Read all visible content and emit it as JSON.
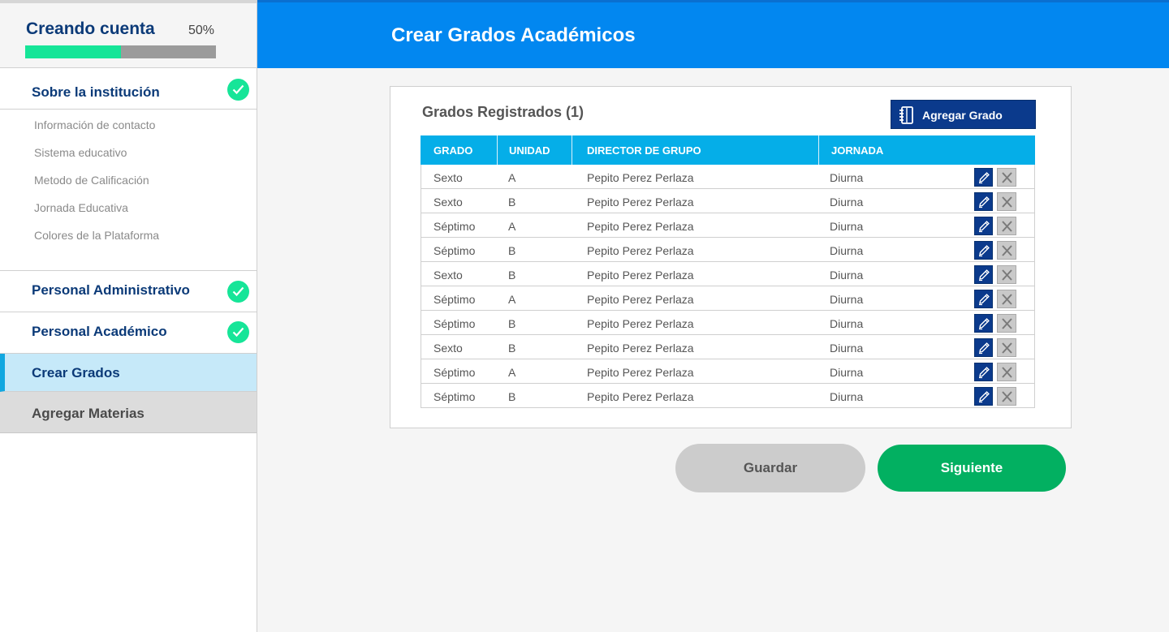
{
  "sidebar": {
    "progress": {
      "title": "Creando cuenta",
      "percent_label": "50%",
      "value": 0.5
    },
    "sections": [
      {
        "label": "Sobre la institución",
        "completed": true
      },
      {
        "label": "Personal Administrativo",
        "completed": true
      },
      {
        "label": "Personal Académico",
        "completed": true
      }
    ],
    "sub_items": [
      "Información de contacto",
      "Sistema educativo",
      "Metodo de Calificación",
      "Jornada Educativa",
      "Colores de la Plataforma"
    ],
    "active_step": "Crear Grados",
    "pending_step": "Agregar Materias"
  },
  "header": {
    "title": "Crear Grados Académicos"
  },
  "card": {
    "title": "Grados Registrados (1)",
    "add_button": "Agregar Grado",
    "columns": [
      "GRADO",
      "UNIDAD",
      "DIRECTOR DE GRUPO",
      "JORNADA"
    ],
    "rows": [
      [
        "Sexto",
        "A",
        "Pepito Perez Perlaza",
        "Diurna"
      ],
      [
        "Sexto",
        "B",
        "Pepito Perez Perlaza",
        "Diurna"
      ],
      [
        "Séptimo",
        "A",
        "Pepito Perez Perlaza",
        "Diurna"
      ],
      [
        "Séptimo",
        "B",
        "Pepito Perez Perlaza",
        "Diurna"
      ],
      [
        "Sexto",
        "B",
        "Pepito Perez Perlaza",
        "Diurna"
      ],
      [
        "Séptimo",
        "A",
        "Pepito Perez Perlaza",
        "Diurna"
      ],
      [
        "Séptimo",
        "B",
        "Pepito Perez Perlaza",
        "Diurna"
      ],
      [
        "Sexto",
        "B",
        "Pepito Perez Perlaza",
        "Diurna"
      ],
      [
        "Séptimo",
        "A",
        "Pepito Perez Perlaza",
        "Diurna"
      ],
      [
        "Séptimo",
        "B",
        "Pepito Perez Perlaza",
        "Diurna"
      ]
    ],
    "row_icons": {
      "edit": "pencil-icon",
      "delete": "close-icon"
    }
  },
  "actions": {
    "save": "Guardar",
    "next": "Siguiente"
  },
  "colors": {
    "primary_blue": "#0287f0",
    "navy": "#0b3a8c",
    "success_green": "#02b061",
    "progress_green": "#16e598",
    "table_header": "#05aee8"
  }
}
